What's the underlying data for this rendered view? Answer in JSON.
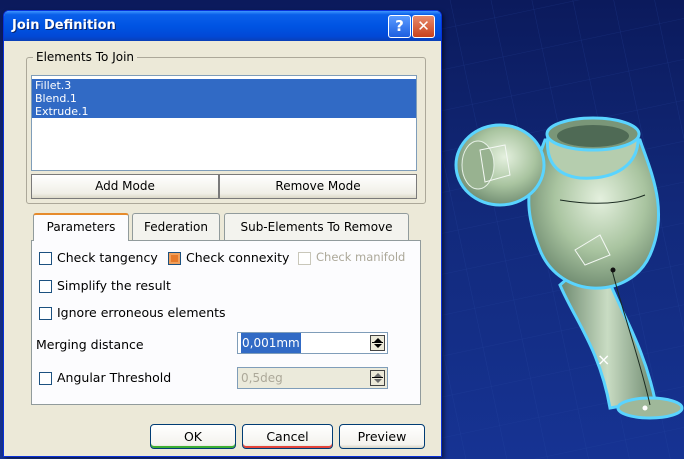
{
  "window": {
    "title": "Join Definition",
    "help_glyph": "?",
    "close_glyph": "✕"
  },
  "elements_group": {
    "label": "Elements To Join",
    "items": [
      "Fillet.3",
      "Blend.1",
      "Extrude.1"
    ],
    "add_mode_label": "Add Mode",
    "remove_mode_label": "Remove Mode"
  },
  "tabs": [
    {
      "label": "Parameters",
      "active": true
    },
    {
      "label": "Federation",
      "active": false
    },
    {
      "label": "Sub-Elements To Remove",
      "active": false
    }
  ],
  "parameters": {
    "check_tangency": {
      "label": "Check tangency",
      "checked": false,
      "enabled": true
    },
    "check_connexity": {
      "label": "Check connexity",
      "checked": true,
      "enabled": true
    },
    "check_manifold": {
      "label": "Check manifold",
      "checked": false,
      "enabled": false
    },
    "simplify": {
      "label": "Simplify the result",
      "checked": false
    },
    "ignore_erroneous": {
      "label": "Ignore erroneous elements",
      "checked": false
    },
    "merging_distance": {
      "label": "Merging distance",
      "value": "0,001mm"
    },
    "angular_threshold": {
      "label": "Angular Threshold",
      "checked": false,
      "value": "0,5deg"
    }
  },
  "buttons": {
    "ok": "OK",
    "cancel": "Cancel",
    "preview": "Preview"
  },
  "viewport": {
    "marker": "×",
    "colors": {
      "background": "#12297a",
      "part_fill": "#a9c4a0",
      "highlight": "#5ad4ff"
    }
  }
}
